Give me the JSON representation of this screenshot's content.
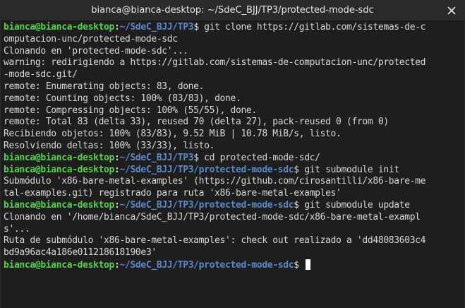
{
  "window": {
    "title": "bianca@bianca-desktop: ~/SdeC_BJJ/TP3/protected-mode-sdc"
  },
  "icons": {
    "close": "close-icon"
  },
  "colors": {
    "background": "#1e1e1e",
    "user": "#58d04f",
    "path": "#5c88c9",
    "text": "#d8d8d8"
  },
  "terminal": {
    "prompt_user": "bianca@bianca-desktop",
    "prompt_colon": ":",
    "lines": [
      {
        "path": "~/SdeC_BJJ/TP3",
        "cmd": "$ git clone https://gitlab.com/sistemas-de-c"
      },
      {
        "text": "omputacion-unc/protected-mode-sdc"
      },
      {
        "text": "Clonando en 'protected-mode-sdc'..."
      },
      {
        "text": "warning: redirigiendo a https://gitlab.com/sistemas-de-computacion-unc/protected"
      },
      {
        "text": "-mode-sdc.git/"
      },
      {
        "text": "remote: Enumerating objects: 83, done."
      },
      {
        "text": "remote: Counting objects: 100% (83/83), done."
      },
      {
        "text": "remote: Compressing objects: 100% (55/55), done."
      },
      {
        "text": "remote: Total 83 (delta 33), reused 70 (delta 27), pack-reused 0 (from 0)"
      },
      {
        "text": "Recibiendo objetos: 100% (83/83), 9.52 MiB | 10.78 MiB/s, listo."
      },
      {
        "text": "Resolviendo deltas: 100% (33/33), listo."
      },
      {
        "path": "~/SdeC_BJJ/TP3",
        "cmd": "$ cd protected-mode-sdc/"
      },
      {
        "path": "~/SdeC_BJJ/TP3/protected-mode-sdc",
        "cmd": "$ git submodule init"
      },
      {
        "text": "Submódulo 'x86-bare-metal-examples' (https://github.com/cirosantilli/x86-bare-me"
      },
      {
        "text": "tal-examples.git) registrado para ruta 'x86-bare-metal-examples'"
      },
      {
        "path": "~/SdeC_BJJ/TP3/protected-mode-sdc",
        "cmd": "$ git submodule update"
      },
      {
        "text": "Clonando en '/home/bianca/SdeC_BJJ/TP3/protected-mode-sdc/x86-bare-metal-exampl"
      },
      {
        "text": "s'..."
      },
      {
        "text": "Ruta de submódulo 'x86-bare-metal-examples': check out realizado a 'dd48083603c4"
      },
      {
        "text": "bd9a96ac4a186e011218618190e3'"
      },
      {
        "path": "~/SdeC_BJJ/TP3/protected-mode-sdc",
        "cmd": "$ ",
        "cursor": true
      }
    ]
  }
}
